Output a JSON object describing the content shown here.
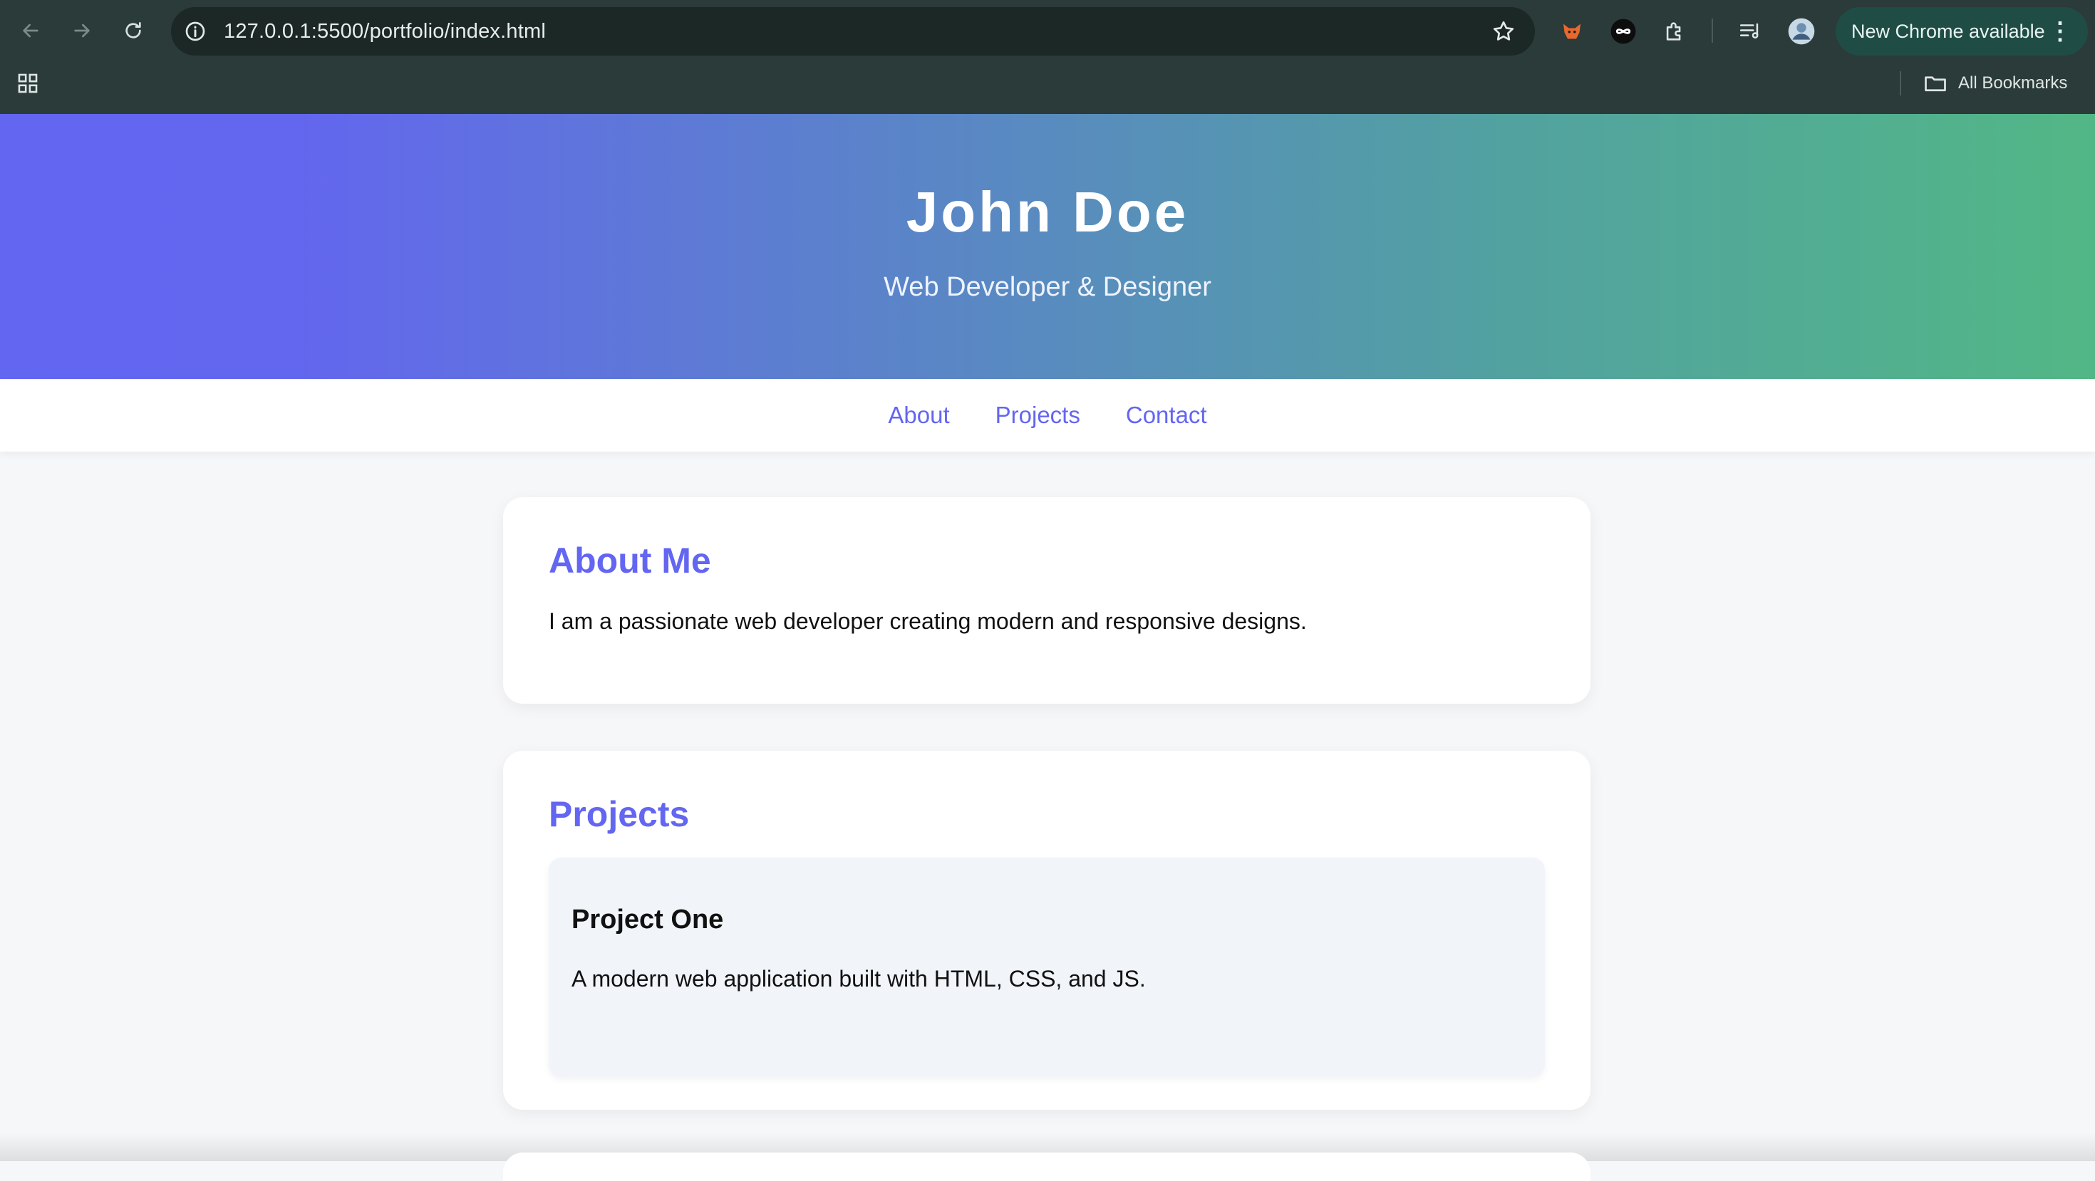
{
  "browser": {
    "url": "127.0.0.1:5500/portfolio/index.html",
    "update_label": "New Chrome available",
    "bookmarks_label": "All Bookmarks",
    "icons": [
      "back-icon",
      "forward-icon",
      "reload-icon",
      "site-info-icon",
      "bookmark-star-icon",
      "extension-fox-icon",
      "extension-infinity-icon",
      "extensions-puzzle-icon",
      "reading-list-icon",
      "profile-avatar",
      "more-menu-icon",
      "apps-grid-icon",
      "folder-icon"
    ]
  },
  "hero": {
    "title": "John Doe",
    "subtitle": "Web Developer & Designer"
  },
  "nav": {
    "items": [
      {
        "label": "About"
      },
      {
        "label": "Projects"
      },
      {
        "label": "Contact"
      }
    ]
  },
  "about": {
    "heading": "About Me",
    "text": "I am a passionate web developer creating modern and responsive designs."
  },
  "projects": {
    "heading": "Projects",
    "items": [
      {
        "title": "Project One",
        "description": "A modern web application built with HTML, CSS, and JS."
      }
    ]
  },
  "colors": {
    "accent": "#6366f1",
    "gradient_start": "#6366f1",
    "gradient_end": "#52b786",
    "chrome_bg": "#2a3b39",
    "update_pill": "#1f4d45"
  }
}
